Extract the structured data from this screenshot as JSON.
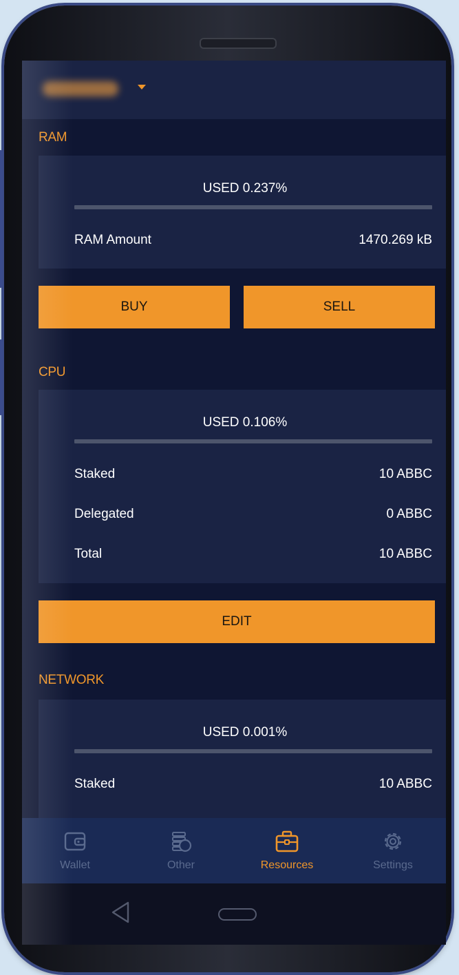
{
  "header": {
    "account_name_blurred": "account-name (obscured)",
    "dropdown_icon": "caret-down-icon"
  },
  "colors": {
    "accent": "#f0962a",
    "background": "#0f1633",
    "card": "#1a2344",
    "tabbar": "#1a2a55",
    "inactive": "#5a6a8e"
  },
  "ram": {
    "title": "RAM",
    "used_text": "USED 0.237%",
    "used_fraction": 0.00237,
    "amount_label": "RAM Amount",
    "amount_value": "1470.269 kB",
    "buy_label": "BUY",
    "sell_label": "SELL"
  },
  "cpu": {
    "title": "CPU",
    "used_text": "USED 0.106%",
    "used_fraction": 0.00106,
    "rows": [
      {
        "label": "Staked",
        "value": "10 ABBC"
      },
      {
        "label": "Delegated",
        "value": "0 ABBC"
      },
      {
        "label": "Total",
        "value": "10 ABBC"
      }
    ],
    "edit_label": "EDIT"
  },
  "network": {
    "title": "NETWORK",
    "used_text": "USED 0.001%",
    "used_fraction": 1e-05,
    "rows": [
      {
        "label": "Staked",
        "value": "10 ABBC"
      }
    ]
  },
  "tabs": [
    {
      "label": "Wallet",
      "icon": "wallet-icon",
      "active": false
    },
    {
      "label": "Other",
      "icon": "coins-icon",
      "active": false
    },
    {
      "label": "Resources",
      "icon": "briefcase-icon",
      "active": true
    },
    {
      "label": "Settings",
      "icon": "gear-icon",
      "active": false
    }
  ],
  "system_nav": {
    "back_icon": "back-triangle-icon",
    "home_icon": "home-pill-icon"
  }
}
